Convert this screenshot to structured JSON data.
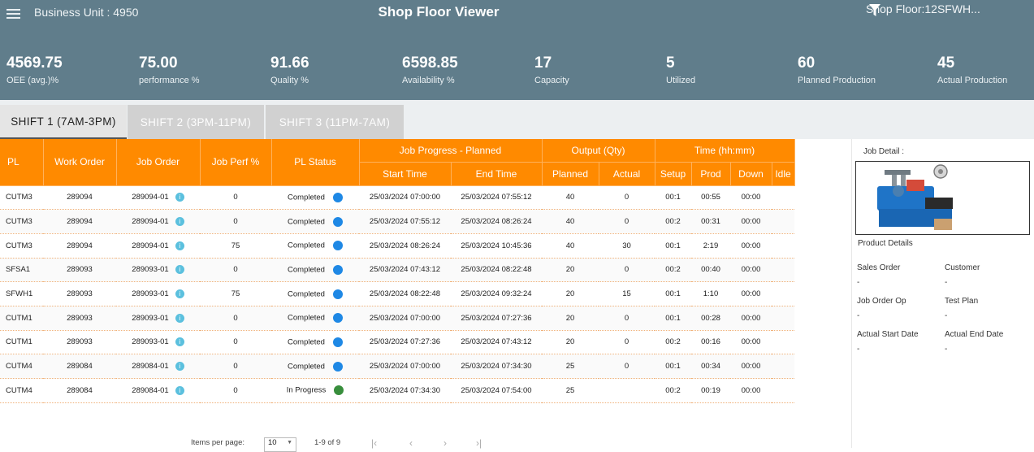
{
  "header": {
    "business_unit": "Business Unit : 4950",
    "title": "Shop Floor Viewer",
    "shop_floor": "Shop Floor:12SFWH..."
  },
  "kpis": [
    {
      "value": "4569.75",
      "label": "OEE (avg.)%"
    },
    {
      "value": "75.00",
      "label": "performance %"
    },
    {
      "value": "91.66",
      "label": "Quality %"
    },
    {
      "value": "6598.85",
      "label": "Availability %"
    },
    {
      "value": "17",
      "label": "Capacity"
    },
    {
      "value": "5",
      "label": "Utilized"
    },
    {
      "value": "60",
      "label": "Planned Production"
    },
    {
      "value": "45",
      "label": "Actual Production"
    }
  ],
  "tabs": [
    {
      "label": "SHIFT 1 (7AM-3PM)"
    },
    {
      "label": "SHIFT 2 (3PM-11PM)"
    },
    {
      "label": "SHIFT 3 (11PM-7AM)"
    }
  ],
  "table": {
    "headers": {
      "pl": "PL",
      "work_order": "Work Order",
      "job_order": "Job Order",
      "job_perf": "Job Perf %",
      "pl_status": "PL Status",
      "job_progress": "Job Progress - Planned",
      "output": "Output (Qty)",
      "time": "Time (hh:mm)",
      "start_time": "Start Time",
      "end_time": "End Time",
      "planned": "Planned",
      "actual": "Actual",
      "setup": "Setup",
      "prod": "Prod",
      "down": "Down",
      "idle": "Idle"
    },
    "rows": [
      {
        "pl": "CUTM3",
        "wo": "289094",
        "jo": "289094-01",
        "perf": "0",
        "status": "Completed",
        "status_color": "#1e88e5",
        "start": "25/03/2024 07:00:00",
        "end": "25/03/2024 07:55:12",
        "planned": "40",
        "actual": "0",
        "setup": "00:1",
        "prod": "00:55",
        "down": "00:00",
        "idle": ""
      },
      {
        "pl": "CUTM3",
        "wo": "289094",
        "jo": "289094-01",
        "perf": "0",
        "status": "Completed",
        "status_color": "#1e88e5",
        "start": "25/03/2024 07:55:12",
        "end": "25/03/2024 08:26:24",
        "planned": "40",
        "actual": "0",
        "setup": "00:2",
        "prod": "00:31",
        "down": "00:00",
        "idle": ""
      },
      {
        "pl": "CUTM3",
        "wo": "289094",
        "jo": "289094-01",
        "perf": "75",
        "status": "Completed",
        "status_color": "#1e88e5",
        "start": "25/03/2024 08:26:24",
        "end": "25/03/2024 10:45:36",
        "planned": "40",
        "actual": "30",
        "setup": "00:1",
        "prod": "2:19",
        "down": "00:00",
        "idle": ""
      },
      {
        "pl": "SFSA1",
        "wo": "289093",
        "jo": "289093-01",
        "perf": "0",
        "status": "Completed",
        "status_color": "#1e88e5",
        "start": "25/03/2024 07:43:12",
        "end": "25/03/2024 08:22:48",
        "planned": "20",
        "actual": "0",
        "setup": "00:2",
        "prod": "00:40",
        "down": "00:00",
        "idle": ""
      },
      {
        "pl": "SFWH1",
        "wo": "289093",
        "jo": "289093-01",
        "perf": "75",
        "status": "Completed",
        "status_color": "#1e88e5",
        "start": "25/03/2024 08:22:48",
        "end": "25/03/2024 09:32:24",
        "planned": "20",
        "actual": "15",
        "setup": "00:1",
        "prod": "1:10",
        "down": "00:00",
        "idle": ""
      },
      {
        "pl": "CUTM1",
        "wo": "289093",
        "jo": "289093-01",
        "perf": "0",
        "status": "Completed",
        "status_color": "#1e88e5",
        "start": "25/03/2024 07:00:00",
        "end": "25/03/2024 07:27:36",
        "planned": "20",
        "actual": "0",
        "setup": "00:1",
        "prod": "00:28",
        "down": "00:00",
        "idle": ""
      },
      {
        "pl": "CUTM1",
        "wo": "289093",
        "jo": "289093-01",
        "perf": "0",
        "status": "Completed",
        "status_color": "#1e88e5",
        "start": "25/03/2024 07:27:36",
        "end": "25/03/2024 07:43:12",
        "planned": "20",
        "actual": "0",
        "setup": "00:2",
        "prod": "00:16",
        "down": "00:00",
        "idle": ""
      },
      {
        "pl": "CUTM4",
        "wo": "289084",
        "jo": "289084-01",
        "perf": "0",
        "status": "Completed",
        "status_color": "#1e88e5",
        "start": "25/03/2024 07:00:00",
        "end": "25/03/2024 07:34:30",
        "planned": "25",
        "actual": "0",
        "setup": "00:1",
        "prod": "00:34",
        "down": "00:00",
        "idle": ""
      },
      {
        "pl": "CUTM4",
        "wo": "289084",
        "jo": "289084-01",
        "perf": "0",
        "status": "In Progress",
        "status_color": "#388e3c",
        "start": "25/03/2024 07:34:30",
        "end": "25/03/2024 07:54:00",
        "planned": "25",
        "actual": "",
        "setup": "00:2",
        "prod": "00:19",
        "down": "00:00",
        "idle": ""
      }
    ]
  },
  "paginator": {
    "items_per_page_label": "Items per page:",
    "page_size": "10",
    "range": "1-9 of 9"
  },
  "detail": {
    "job_detail_label": "Job Detail :",
    "product_details_label": "Product Details",
    "fields": [
      {
        "label": "Sales Order",
        "value": "-"
      },
      {
        "label": "Customer",
        "value": "-"
      },
      {
        "label": "Job Order Op",
        "value": "-"
      },
      {
        "label": "Test Plan",
        "value": "-"
      },
      {
        "label": "Actual Start Date",
        "value": "-"
      },
      {
        "label": "Actual End Date",
        "value": "-"
      }
    ]
  },
  "colors": {
    "header_bg": "#607d8b",
    "table_header": "#ff8a00",
    "completed": "#1e88e5",
    "in_progress": "#388e3c"
  },
  "icons": [
    "menu-icon",
    "filter-icon",
    "info-icon",
    "dropdown-arrow-icon",
    "first-page-icon",
    "prev-page-icon",
    "next-page-icon",
    "last-page-icon"
  ]
}
